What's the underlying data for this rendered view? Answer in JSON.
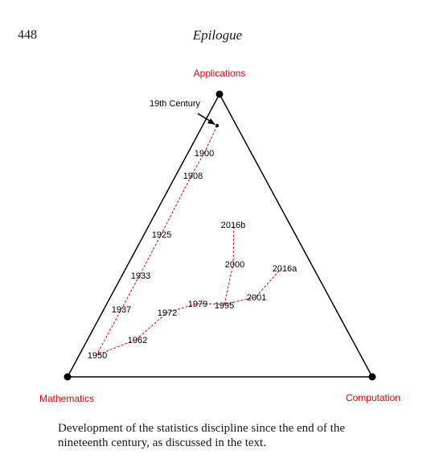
{
  "page": {
    "number": "448",
    "running_head": "Epilogue"
  },
  "figure": {
    "vertices": {
      "applications": "Applications",
      "mathematics": "Mathematics",
      "computation": "Computation"
    },
    "start_annotation": "19th Century",
    "years": [
      "1900",
      "1908",
      "1925",
      "1933",
      "1937",
      "1950",
      "1962",
      "1972",
      "1979",
      "1995",
      "2000",
      "2016b",
      "2001",
      "2016a"
    ],
    "colors": {
      "vertex_label": "#e8000b",
      "trajectory": "#e8000b",
      "triangle": "#000000"
    }
  },
  "caption": "Development of the statistics discipline since the end of the nineteenth century, as discussed in the text."
}
